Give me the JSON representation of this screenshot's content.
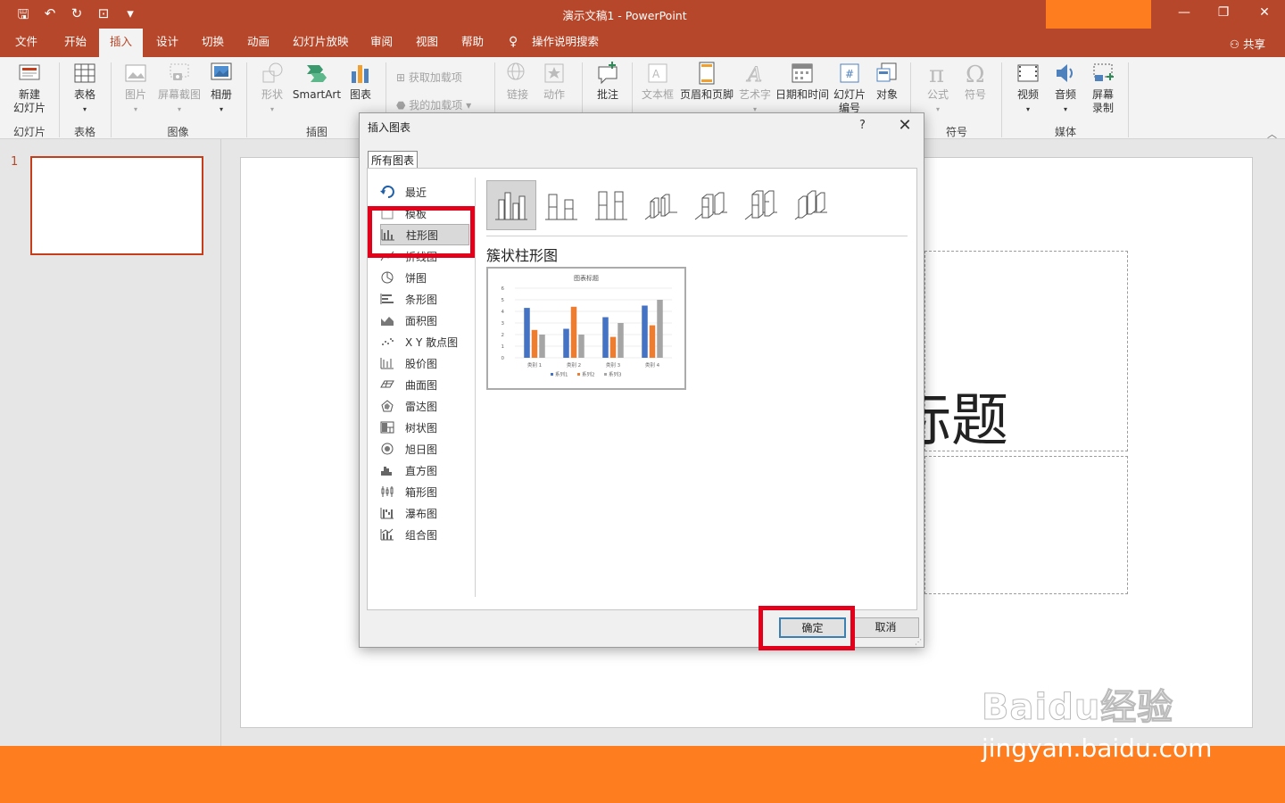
{
  "window": {
    "title": "演示文稿1  -  PowerPoint",
    "share_label": "共享"
  },
  "tabs": [
    "文件",
    "开始",
    "插入",
    "设计",
    "切换",
    "动画",
    "幻灯片放映",
    "审阅",
    "视图",
    "帮助",
    "操作说明搜索"
  ],
  "active_tab": "插入",
  "ribbon": {
    "buttons": {
      "new_slide": "新建\n幻灯片",
      "table": "表格",
      "picture": "图片",
      "screenshot": "屏幕截图",
      "album": "相册",
      "shapes": "形状",
      "smartart": "SmartArt",
      "chart": "图表",
      "get_addins": "获取加载项",
      "my_addins": "我的加载项",
      "link": "链接",
      "action": "动作",
      "comment": "批注",
      "textbox": "文本框",
      "header_footer": "页眉和页脚",
      "wordart": "艺术字",
      "date_time": "日期和时间",
      "slide_number": "幻灯片\n编号",
      "object": "对象",
      "equation": "公式",
      "symbol": "符号",
      "video": "视频",
      "audio": "音频",
      "screen_record": "屏幕\n录制"
    },
    "groups": {
      "slides": "幻灯片",
      "tables": "表格",
      "images": "图像",
      "illustrations": "插图",
      "symbols": "符号",
      "media": "媒体"
    }
  },
  "slide_pane": {
    "slide_number": "1"
  },
  "slide": {
    "title_fragment": "标题"
  },
  "dialog": {
    "title": "插入图表",
    "help": "?",
    "close": "✕",
    "tab_label": "所有图表",
    "categories": [
      "最近",
      "模板",
      "柱形图",
      "折线图",
      "饼图",
      "条形图",
      "面积图",
      "X Y 散点图",
      "股价图",
      "曲面图",
      "雷达图",
      "树状图",
      "旭日图",
      "直方图",
      "箱形图",
      "瀑布图",
      "组合图"
    ],
    "selected_category": "柱形图",
    "subtype_name": "簇状柱形图",
    "ok_label": "确定",
    "cancel_label": "取消"
  },
  "chart_data": {
    "type": "bar",
    "title": "图表标题",
    "categories": [
      "类别 1",
      "类别 2",
      "类别 3",
      "类别 4"
    ],
    "series": [
      {
        "name": "系列1",
        "values": [
          4.3,
          2.5,
          3.5,
          4.5
        ],
        "color": "#4472c4"
      },
      {
        "name": "系列2",
        "values": [
          2.4,
          4.4,
          1.8,
          2.8
        ],
        "color": "#ed7d31"
      },
      {
        "name": "系列3",
        "values": [
          2,
          2,
          3,
          5
        ],
        "color": "#a5a5a5"
      }
    ],
    "ylim": [
      0,
      6
    ],
    "yticks": [
      "0",
      "1",
      "2",
      "3",
      "4",
      "5",
      "6"
    ],
    "grid": true,
    "legend": "bottom"
  },
  "watermark": {
    "brand": "Baidu经验",
    "url": "jingyan.baidu.com"
  },
  "colors": {
    "accent": "#b7472a",
    "highlight": "#e3001b",
    "footer": "#fd7d1f"
  }
}
